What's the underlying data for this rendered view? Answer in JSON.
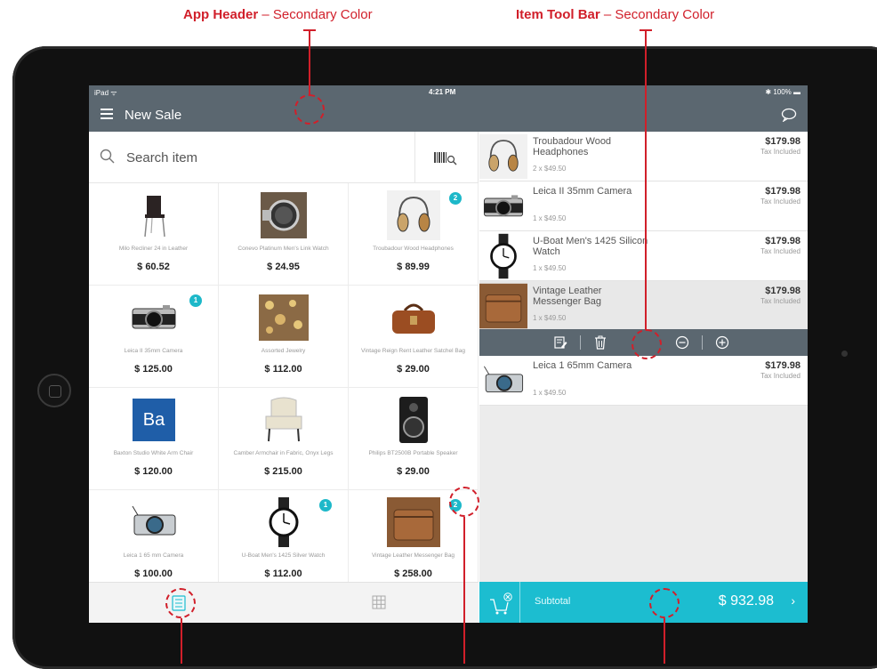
{
  "callouts": {
    "app_header": {
      "title": "App Header",
      "sep": " – ",
      "desc": "Secondary Color"
    },
    "item_toolbar": {
      "title": "Item Tool Bar",
      "sep": " – ",
      "desc": "Secondary Color"
    }
  },
  "status_bar": {
    "left": "iPad ᯤ",
    "time": "4:21 PM",
    "right": "✱ 100% ▬"
  },
  "app_bar": {
    "title": "New Sale",
    "menu_icon": "hamburger-icon",
    "chat_icon": "chat-bubble-icon"
  },
  "search": {
    "placeholder": "Search item",
    "icon": "search-icon",
    "scan_icon": "barcode-scan-icon"
  },
  "products": [
    {
      "name": "Milo Recliner 24 in Leather",
      "price": "$ 60.52",
      "img": "chair",
      "badge": ""
    },
    {
      "name": "Conevo Platinum Men's Link Watch",
      "price": "$ 24.95",
      "img": "watch-steel",
      "badge": ""
    },
    {
      "name": "Troubadour Wood Headphones",
      "price": "$ 89.99",
      "img": "headphones",
      "badge": "2"
    },
    {
      "name": "Leica II 35mm Camera",
      "price": "$ 125.00",
      "img": "camera",
      "badge": "1"
    },
    {
      "name": "Assorted Jewelry",
      "price": "$ 112.00",
      "img": "jewelry",
      "badge": ""
    },
    {
      "name": "Vintage Reign Rent Leather Satchel Bag",
      "price": "$ 29.00",
      "img": "satchel",
      "badge": ""
    },
    {
      "name": "Baxton Studio White Arm Chair",
      "price": "$ 120.00",
      "img": "ba-logo",
      "badge": ""
    },
    {
      "name": "Camber Armchair in Fabric, Onyx Legs",
      "price": "$ 215.00",
      "img": "armchair",
      "badge": ""
    },
    {
      "name": "Philips BT2500B Portable Speaker",
      "price": "$ 29.00",
      "img": "speaker",
      "badge": ""
    },
    {
      "name": "Leica 1 65 mm Camera",
      "price": "$ 100.00",
      "img": "camera2",
      "badge": ""
    },
    {
      "name": "U-Boat Men's 1425 Silver Watch",
      "price": "$ 112.00",
      "img": "watch-black",
      "badge": "1"
    },
    {
      "name": "Vintage Leather Messenger Bag",
      "price": "$ 258.00",
      "img": "messenger",
      "badge": "2"
    }
  ],
  "ba_logo_text": "Ba",
  "cart": [
    {
      "name": "Troubadour Wood Headphones",
      "qty": "2 x $49.50",
      "price": "$179.98",
      "tax": "Tax Included",
      "img": "headphones"
    },
    {
      "name": "Leica II 35mm Camera",
      "qty": "1 x $49.50",
      "price": "$179.98",
      "tax": "Tax Included",
      "img": "camera"
    },
    {
      "name": "U-Boat Men's 1425 Silicon Watch",
      "qty": "1 x $49.50",
      "price": "$179.98",
      "tax": "Tax Included",
      "img": "watch-black"
    },
    {
      "name": "Vintage Leather Messenger Bag",
      "qty": "1 x $49.50",
      "price": "$179.98",
      "tax": "Tax Included",
      "img": "messenger"
    },
    {
      "name": "Leica 1 65mm Camera",
      "qty": "1 x $49.50",
      "price": "$179.98",
      "tax": "Tax Included",
      "img": "camera2"
    }
  ],
  "toolbar": {
    "icons": [
      "edit-note-icon",
      "trash-icon",
      "minus-circle-icon",
      "plus-circle-icon"
    ]
  },
  "subtotal": {
    "label": "Subtotal",
    "value": "$ 932.98",
    "chevron": "›"
  },
  "colors": {
    "secondary": "#5b6770",
    "accent": "#1cbdd0",
    "callout": "#d11f2a"
  }
}
